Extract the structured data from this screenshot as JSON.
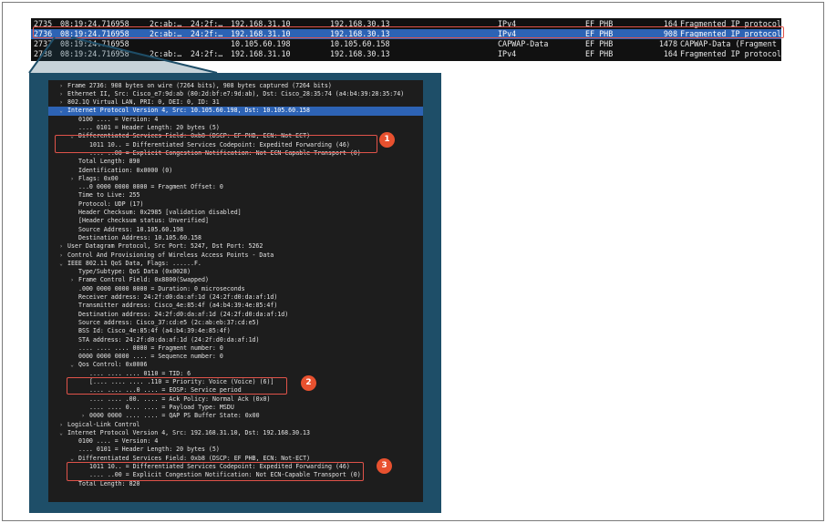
{
  "colors": {
    "accent": "#e0534a",
    "badge": "#e8512f",
    "selection": "#2d63b5",
    "frame": "#1e4e68"
  },
  "packet_list": {
    "rows": [
      {
        "no": "2735",
        "time": "08:19:24.716958",
        "src_mac": "2c:ab:…",
        "dst_mac": "24:2f:…",
        "src": "192.168.31.10",
        "dst": "192.168.30.13",
        "proto": "IPv4",
        "dscp": "EF PHB",
        "len": "164",
        "info": "Fragmented IP protocol"
      },
      {
        "no": "2736",
        "time": "08:19:24.716958",
        "src_mac": "2c:ab:…",
        "dst_mac": "24:2f:…",
        "src": "192.168.31.10",
        "dst": "192.168.30.13",
        "proto": "IPv4",
        "dscp": "EF PHB",
        "len": "908",
        "info": "Fragmented IP protocol"
      },
      {
        "no": "2737",
        "time": "08:19:24.716958",
        "src_mac": "",
        "dst_mac": "",
        "src": "10.105.60.198",
        "dst": "10.105.60.158",
        "proto": "CAPWAP-Data",
        "dscp": "EF PHB",
        "len": "1478",
        "info": "CAPWAP-Data (Fragment I"
      },
      {
        "no": "2738",
        "time": "08:19:24.716958",
        "src_mac": "2c:ab:…",
        "dst_mac": "24:2f:…",
        "src": "192.168.31.10",
        "dst": "192.168.30.13",
        "proto": "IPv4",
        "dscp": "EF PHB",
        "len": "164",
        "info": "Fragmented IP protocol"
      }
    ]
  },
  "details": {
    "lines": [
      {
        "indent": 0,
        "twisty": ">",
        "text": "Frame 2736: 908 bytes on wire (7264 bits), 908 bytes captured (7264 bits)"
      },
      {
        "indent": 0,
        "twisty": ">",
        "text": "Ethernet II, Src: Cisco_e7:9d:ab (80:2d:bf:e7:9d:ab), Dst: Cisco_28:35:74 (a4:b4:39:28:35:74)"
      },
      {
        "indent": 0,
        "twisty": ">",
        "text": "802.1Q Virtual LAN, PRI: 0, DEI: 0, ID: 31"
      },
      {
        "indent": 0,
        "twisty": "v",
        "text": "Internet Protocol Version 4, Src: 10.105.60.198, Dst: 10.105.60.158"
      },
      {
        "indent": 1,
        "twisty": "",
        "text": "0100 .... = Version: 4"
      },
      {
        "indent": 1,
        "twisty": "",
        "text": ".... 0101 = Header Length: 20 bytes (5)"
      },
      {
        "indent": 1,
        "twisty": "v",
        "text": "Differentiated Services Field: 0xb8 (DSCP: EF PHB, ECN: Not-ECT)"
      },
      {
        "indent": 2,
        "twisty": "",
        "text": "1011 10.. = Differentiated Services Codepoint: Expedited Forwarding (46)"
      },
      {
        "indent": 2,
        "twisty": "",
        "text": ".... ..00 = Explicit Congestion Notification: Not ECN-Capable Transport (0)"
      },
      {
        "indent": 1,
        "twisty": "",
        "text": "Total Length: 890"
      },
      {
        "indent": 1,
        "twisty": "",
        "text": "Identification: 0x0000 (0)"
      },
      {
        "indent": 1,
        "twisty": ">",
        "text": "Flags: 0x00"
      },
      {
        "indent": 1,
        "twisty": "",
        "text": "...0 0000 0000 0000 = Fragment Offset: 0"
      },
      {
        "indent": 1,
        "twisty": "",
        "text": "Time to Live: 255"
      },
      {
        "indent": 1,
        "twisty": "",
        "text": "Protocol: UDP (17)"
      },
      {
        "indent": 1,
        "twisty": "",
        "text": "Header Checksum: 0x2985 [validation disabled]"
      },
      {
        "indent": 1,
        "twisty": "",
        "text": "[Header checksum status: Unverified]"
      },
      {
        "indent": 1,
        "twisty": "",
        "text": "Source Address: 10.105.60.198"
      },
      {
        "indent": 1,
        "twisty": "",
        "text": "Destination Address: 10.105.60.158"
      },
      {
        "indent": 0,
        "twisty": ">",
        "text": "User Datagram Protocol, Src Port: 5247, Dst Port: 5262"
      },
      {
        "indent": 0,
        "twisty": ">",
        "text": "Control And Provisioning of Wireless Access Points - Data"
      },
      {
        "indent": 0,
        "twisty": "v",
        "text": "IEEE 802.11 QoS Data, Flags: ......F."
      },
      {
        "indent": 1,
        "twisty": "",
        "text": "Type/Subtype: QoS Data (0x0028)"
      },
      {
        "indent": 1,
        "twisty": ">",
        "text": "Frame Control Field: 0x8800(Swapped)"
      },
      {
        "indent": 1,
        "twisty": "",
        "text": ".000 0000 0000 0000 = Duration: 0 microseconds"
      },
      {
        "indent": 1,
        "twisty": "",
        "text": "Receiver address: 24:2f:d0:da:af:1d (24:2f:d0:da:af:1d)"
      },
      {
        "indent": 1,
        "twisty": "",
        "text": "Transmitter address: Cisco_4e:85:4f (a4:b4:39:4e:85:4f)"
      },
      {
        "indent": 1,
        "twisty": "",
        "text": "Destination address: 24:2f:d0:da:af:1d (24:2f:d0:da:af:1d)"
      },
      {
        "indent": 1,
        "twisty": "",
        "text": "Source address: Cisco_37:cd:e5 (2c:ab:eb:37:cd:e5)"
      },
      {
        "indent": 1,
        "twisty": "",
        "text": "BSS Id: Cisco_4e:85:4f (a4:b4:39:4e:85:4f)"
      },
      {
        "indent": 1,
        "twisty": "",
        "text": "STA address: 24:2f:d0:da:af:1d (24:2f:d0:da:af:1d)"
      },
      {
        "indent": 1,
        "twisty": "",
        "text": ".... .... .... 0000 = Fragment number: 0"
      },
      {
        "indent": 1,
        "twisty": "",
        "text": "0000 0000 0000 .... = Sequence number: 0"
      },
      {
        "indent": 1,
        "twisty": "v",
        "text": "Qos Control: 0x0006"
      },
      {
        "indent": 2,
        "twisty": "",
        "text": ".... .... .... 0110 = TID: 6"
      },
      {
        "indent": 2,
        "twisty": "",
        "text": "[.... .... .... .110 = Priority: Voice (Voice) (6)]"
      },
      {
        "indent": 2,
        "twisty": "",
        "text": ".... .... ...0 .... = EOSP: Service period"
      },
      {
        "indent": 2,
        "twisty": "",
        "text": ".... .... .00. .... = Ack Policy: Normal Ack (0x0)"
      },
      {
        "indent": 2,
        "twisty": "",
        "text": ".... .... 0... .... = Payload Type: MSDU"
      },
      {
        "indent": 2,
        "twisty": ">",
        "text": "0000 0000 .... .... = QAP PS Buffer State: 0x00"
      },
      {
        "indent": 0,
        "twisty": ">",
        "text": "Logical-Link Control"
      },
      {
        "indent": 0,
        "twisty": "v",
        "text": "Internet Protocol Version 4, Src: 192.168.31.10, Dst: 192.168.30.13"
      },
      {
        "indent": 1,
        "twisty": "",
        "text": "0100 .... = Version: 4"
      },
      {
        "indent": 1,
        "twisty": "",
        "text": ".... 0101 = Header Length: 20 bytes (5)"
      },
      {
        "indent": 1,
        "twisty": "v",
        "text": "Differentiated Services Field: 0xb8 (DSCP: EF PHB, ECN: Not-ECT)"
      },
      {
        "indent": 2,
        "twisty": "",
        "text": "1011 10.. = Differentiated Services Codepoint: Expedited Forwarding (46)"
      },
      {
        "indent": 2,
        "twisty": "",
        "text": ".... ..00 = Explicit Congestion Notification: Not ECN-Capable Transport (0)"
      },
      {
        "indent": 1,
        "twisty": "",
        "text": "Total Length: 820"
      }
    ]
  },
  "callouts": [
    "1",
    "2",
    "3"
  ]
}
